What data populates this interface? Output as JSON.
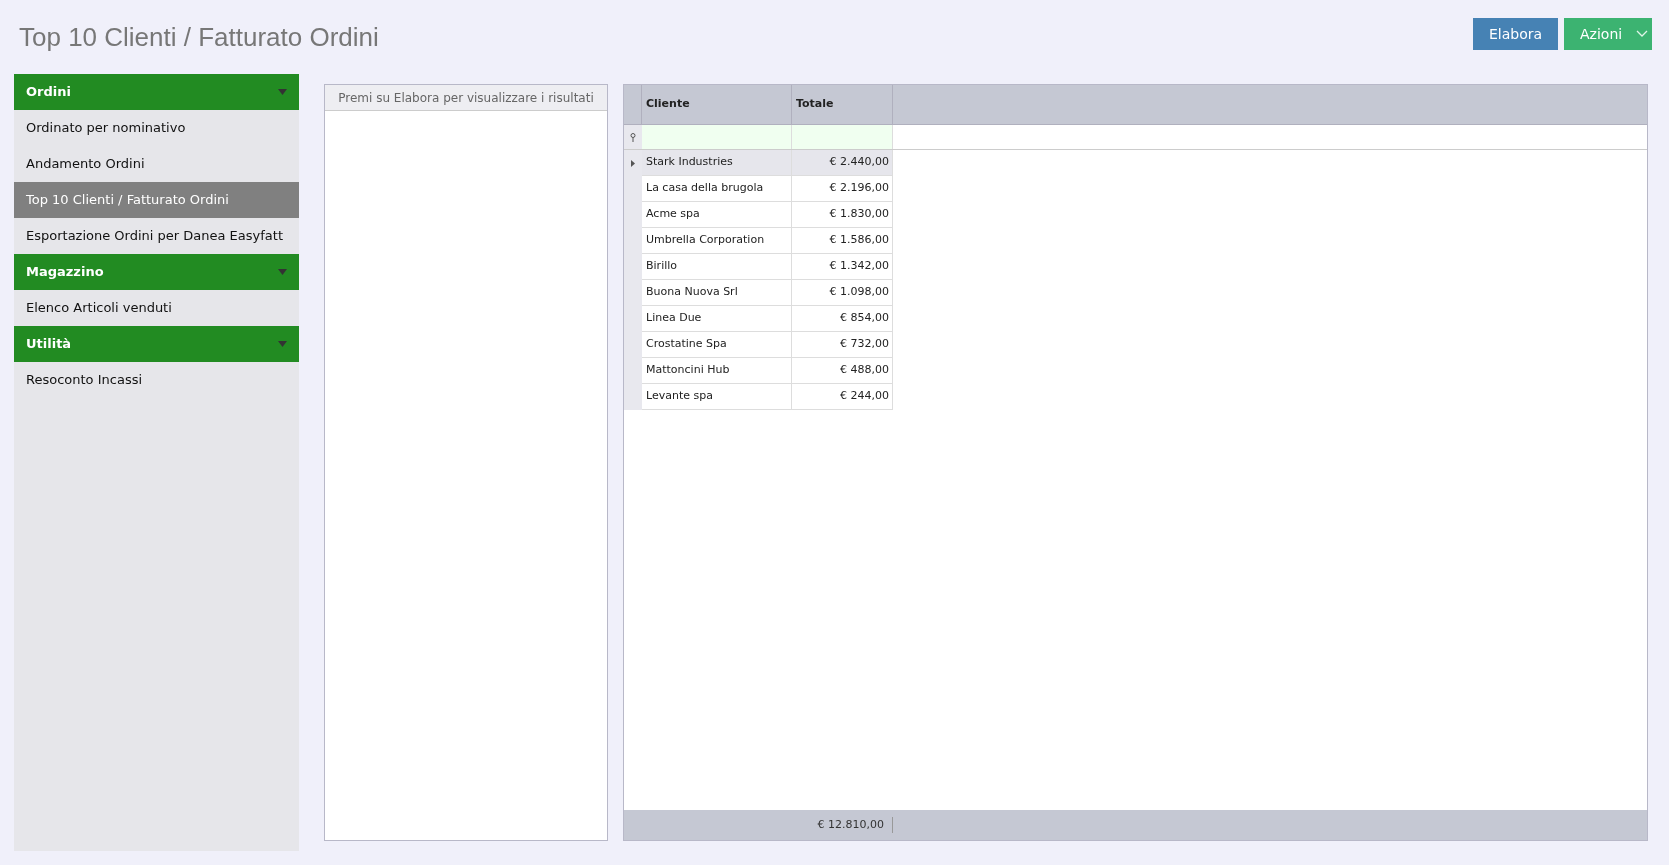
{
  "page_title": "Top 10 Clienti / Fatturato Ordini",
  "toolbar": {
    "process_button": "Elabora",
    "actions_button": "Azioni"
  },
  "sidebar": {
    "groups": [
      {
        "label": "Ordini",
        "items": [
          {
            "label": "Ordinato per nominativo",
            "selected": false
          },
          {
            "label": "Andamento Ordini",
            "selected": false
          },
          {
            "label": "Top 10 Clienti / Fatturato Ordini",
            "selected": true
          },
          {
            "label": "Esportazione Ordini per Danea Easyfatt",
            "selected": false
          }
        ]
      },
      {
        "label": "Magazzino",
        "items": [
          {
            "label": "Elenco Articoli venduti",
            "selected": false
          }
        ]
      },
      {
        "label": "Utilità",
        "items": [
          {
            "label": "Resoconto Incassi",
            "selected": false
          }
        ]
      }
    ]
  },
  "chart_panel": {
    "message": "Premi su Elabora per visualizzare i risultati"
  },
  "table": {
    "columns": [
      "Cliente",
      "Totale"
    ],
    "rows": [
      {
        "cells": [
          "Stark Industries",
          "€ 2.440,00"
        ],
        "selected": true
      },
      {
        "cells": [
          "La casa della brugola",
          "€ 2.196,00"
        ],
        "selected": false
      },
      {
        "cells": [
          "Acme spa",
          "€ 1.830,00"
        ],
        "selected": false
      },
      {
        "cells": [
          "Umbrella Corporation",
          "€ 1.586,00"
        ],
        "selected": false
      },
      {
        "cells": [
          "Birillo",
          "€ 1.342,00"
        ],
        "selected": false
      },
      {
        "cells": [
          "Buona Nuova Srl",
          "€ 1.098,00"
        ],
        "selected": false
      },
      {
        "cells": [
          "Linea Due",
          "€ 854,00"
        ],
        "selected": false
      },
      {
        "cells": [
          "Crostatine Spa",
          "€ 732,00"
        ],
        "selected": false
      },
      {
        "cells": [
          "Mattoncini Hub",
          "€ 488,00"
        ],
        "selected": false
      },
      {
        "cells": [
          "Levante spa",
          "€ 244,00"
        ],
        "selected": false
      }
    ],
    "footer_total": "€ 12.810,00"
  }
}
